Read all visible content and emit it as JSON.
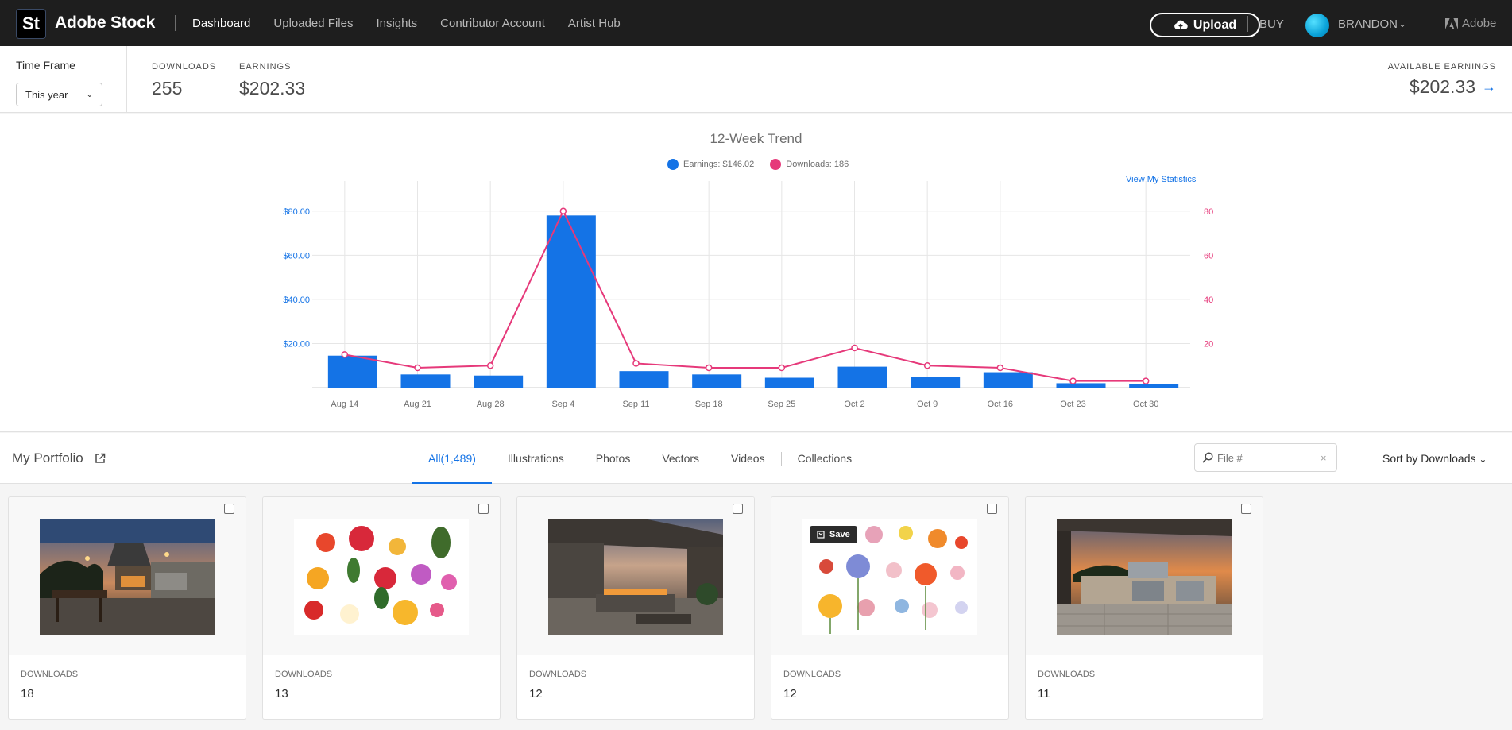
{
  "header": {
    "logo": "St",
    "brand": "Adobe Stock",
    "nav": [
      "Dashboard",
      "Uploaded Files",
      "Insights",
      "Contributor Account",
      "Artist Hub"
    ],
    "upload": "Upload",
    "buy": "BUY",
    "user": "BRANDON",
    "adobe": "Adobe"
  },
  "stats": {
    "timeframe_label": "Time Frame",
    "timeframe_value": "This year",
    "downloads_label": "DOWNLOADS",
    "downloads_value": "255",
    "earnings_label": "EARNINGS",
    "earnings_value": "$202.33",
    "available_label": "AVAILABLE EARNINGS",
    "available_value": "$202.33"
  },
  "chart": {
    "title": "12-Week Trend",
    "legend_earnings": "Earnings: $146.02",
    "legend_downloads": "Downloads: 186",
    "view_stats": "View My Statistics",
    "colors": {
      "earnings": "#1473e6",
      "downloads": "#e6397a"
    }
  },
  "chart_data": {
    "type": "bar",
    "title": "12-Week Trend",
    "categories": [
      "Aug 14",
      "Aug 21",
      "Aug 28",
      "Sep 4",
      "Sep 11",
      "Sep 18",
      "Sep 25",
      "Oct 2",
      "Oct 9",
      "Oct 16",
      "Oct 23",
      "Oct 30"
    ],
    "series": [
      {
        "name": "Earnings: $146.02",
        "type": "bar",
        "axis": "left",
        "values": [
          14.5,
          6,
          5.5,
          78,
          7.5,
          6,
          4.5,
          9.5,
          5,
          7,
          2,
          1.5
        ]
      },
      {
        "name": "Downloads: 186",
        "type": "line",
        "axis": "right",
        "values": [
          15,
          9,
          10,
          80,
          11,
          9,
          9,
          18,
          10,
          9,
          3,
          3
        ]
      }
    ],
    "y_left_ticks": [
      "$20.00",
      "$40.00",
      "$60.00",
      "$80.00"
    ],
    "y_left_lim": [
      0,
      90
    ],
    "y_right_ticks": [
      "20",
      "40",
      "60",
      "80"
    ],
    "y_right_lim": [
      0,
      90
    ],
    "grid": true
  },
  "portfolio": {
    "title": "My Portfolio",
    "tabs": [
      "All(1,489)",
      "Illustrations",
      "Photos",
      "Vectors",
      "Videos",
      "Collections"
    ],
    "search_placeholder": "File #",
    "sort": "Sort by Downloads",
    "items": [
      {
        "label": "DOWNLOADS",
        "value": "18"
      },
      {
        "label": "DOWNLOADS",
        "value": "13"
      },
      {
        "label": "DOWNLOADS",
        "value": "12"
      },
      {
        "label": "DOWNLOADS",
        "value": "12",
        "save": "Save"
      },
      {
        "label": "DOWNLOADS",
        "value": "11"
      }
    ]
  }
}
